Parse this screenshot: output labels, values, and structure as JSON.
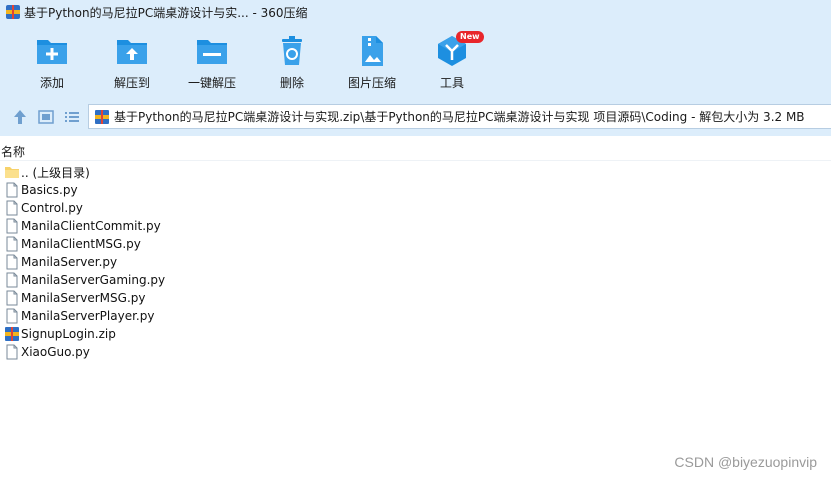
{
  "window": {
    "title": "基于Python的马尼拉PC端桌游设计与实... - 360压缩"
  },
  "toolbar": {
    "add": "添加",
    "extract_to": "解压到",
    "one_click_extract": "一键解压",
    "delete": "删除",
    "image_compress": "图片压缩",
    "tools": "工具",
    "tools_badge": "New"
  },
  "address": {
    "path": "基于Python的马尼拉PC端桌游设计与实现.zip\\基于Python的马尼拉PC端桌游设计与实现 项目源码\\Coding - 解包大小为 3.2 MB"
  },
  "columns": {
    "name": "名称"
  },
  "files": [
    {
      "name": ".. (上级目录)",
      "type": "folder"
    },
    {
      "name": "Basics.py",
      "type": "file"
    },
    {
      "name": "Control.py",
      "type": "file"
    },
    {
      "name": "ManilaClientCommit.py",
      "type": "file"
    },
    {
      "name": "ManilaClientMSG.py",
      "type": "file"
    },
    {
      "name": "ManilaServer.py",
      "type": "file"
    },
    {
      "name": "ManilaServerGaming.py",
      "type": "file"
    },
    {
      "name": "ManilaServerMSG.py",
      "type": "file"
    },
    {
      "name": "ManilaServerPlayer.py",
      "type": "file"
    },
    {
      "name": "SignupLogin.zip",
      "type": "zip"
    },
    {
      "name": "XiaoGuo.py",
      "type": "file"
    }
  ],
  "watermark": "CSDN @biyezuopinvip",
  "colors": {
    "toolbar_bg": "#dcedfb",
    "icon_blue": "#1d8fe0",
    "badge_red": "#e8262b"
  }
}
